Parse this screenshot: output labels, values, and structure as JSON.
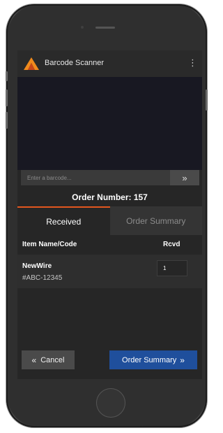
{
  "app": {
    "title": "Barcode Scanner",
    "menu_icon": "more-vertical-icon",
    "logo_icon": "triangle-logo-icon"
  },
  "scan": {
    "placeholder": "Enter a barcode...",
    "button_icon": "double-chevron-right-icon",
    "button_glyph": "»"
  },
  "order": {
    "label": "Order Number: 157"
  },
  "tabs": [
    {
      "label": "Received",
      "active": true
    },
    {
      "label": "Order Summary",
      "active": false
    }
  ],
  "table": {
    "headers": [
      "Item Name/Code",
      "Rcvd"
    ],
    "rows": [
      {
        "name": "NewWire",
        "code": "#ABC-12345",
        "rcvd": "1"
      }
    ]
  },
  "footer": {
    "cancel_label": "Cancel",
    "cancel_glyph": "«",
    "summary_label": "Order Summary",
    "summary_glyph": "»"
  },
  "colors": {
    "accent": "#e3571e",
    "primary_button": "#1f4f9c",
    "screen_bg": "#262626"
  }
}
